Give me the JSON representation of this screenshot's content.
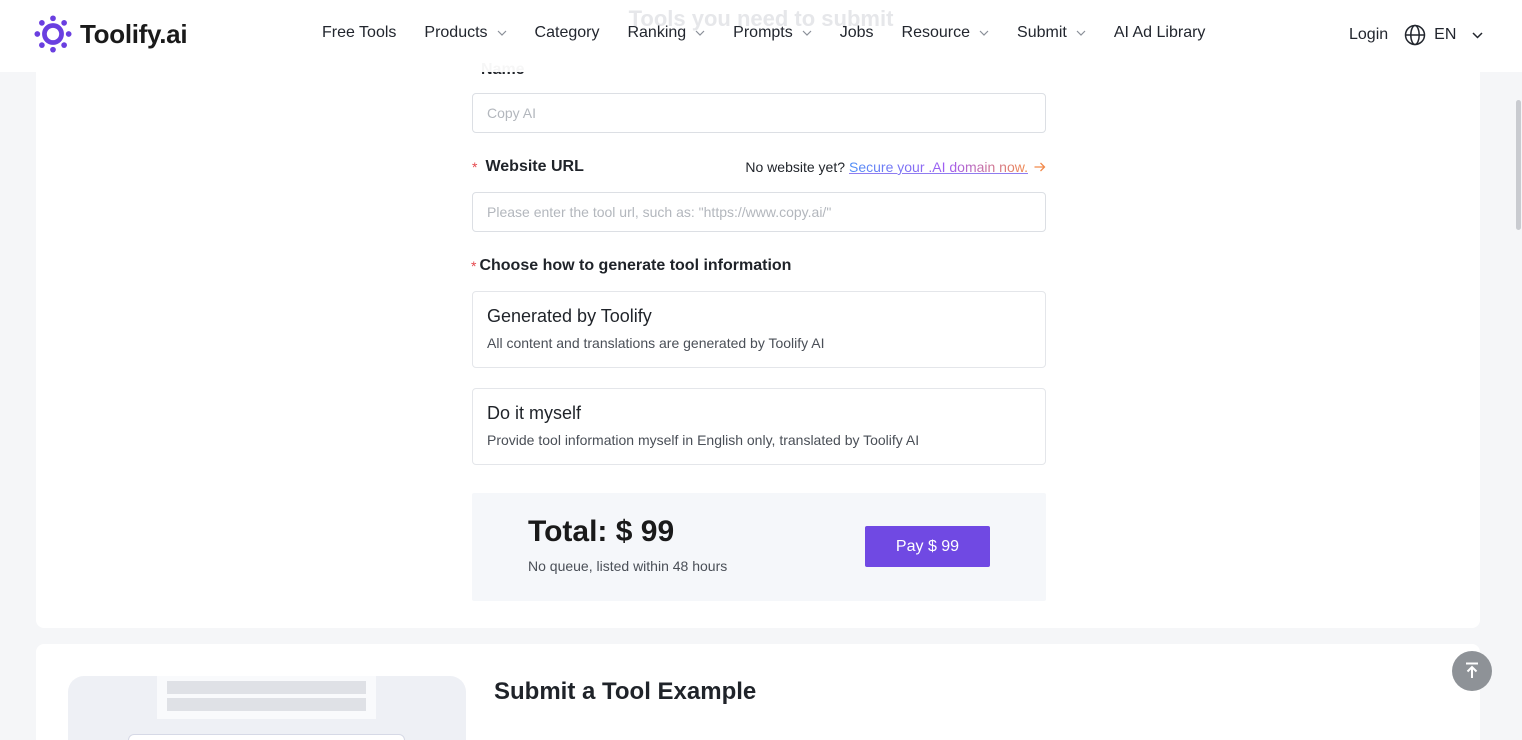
{
  "header": {
    "ghost_heading": "Tools you need to submit",
    "logo_text": "Toolify.ai",
    "nav": [
      {
        "label": "Free Tools",
        "dropdown": false
      },
      {
        "label": "Products",
        "dropdown": true
      },
      {
        "label": "Category",
        "dropdown": false
      },
      {
        "label": "Ranking",
        "dropdown": true
      },
      {
        "label": "Prompts",
        "dropdown": true
      },
      {
        "label": "Jobs",
        "dropdown": false
      },
      {
        "label": "Resource",
        "dropdown": true
      },
      {
        "label": "Submit",
        "dropdown": true
      },
      {
        "label": "AI Ad Library",
        "dropdown": false
      }
    ],
    "login_label": "Login",
    "language": "EN"
  },
  "form": {
    "name_label": "Name",
    "name_placeholder": "Copy AI",
    "required_marker": "*",
    "url_label": "Website URL",
    "url_placeholder": "Please enter the tool url, such as: \"https://www.copy.ai/\"",
    "domain_hint": "No website yet?",
    "domain_link": "Secure your .AI domain now.",
    "choose_label": "Choose how to generate tool information",
    "options": [
      {
        "title": "Generated by Toolify",
        "desc": "All content and translations are generated by Toolify AI"
      },
      {
        "title": "Do it myself",
        "desc": "Provide tool information myself in English only, translated by Toolify AI"
      }
    ]
  },
  "total": {
    "label": "Total: $ 99",
    "sub": "No queue, listed within 48 hours",
    "pay_label": "Pay $ 99"
  },
  "example": {
    "title": "Submit a Tool Example"
  },
  "colors": {
    "accent": "#7049e3",
    "required": "#e5484d",
    "background": "#f5f6f8"
  },
  "icons": [
    "toolify-logo-icon",
    "chevron-down-icon",
    "globe-icon",
    "arrow-right-icon",
    "back-to-top-icon"
  ]
}
